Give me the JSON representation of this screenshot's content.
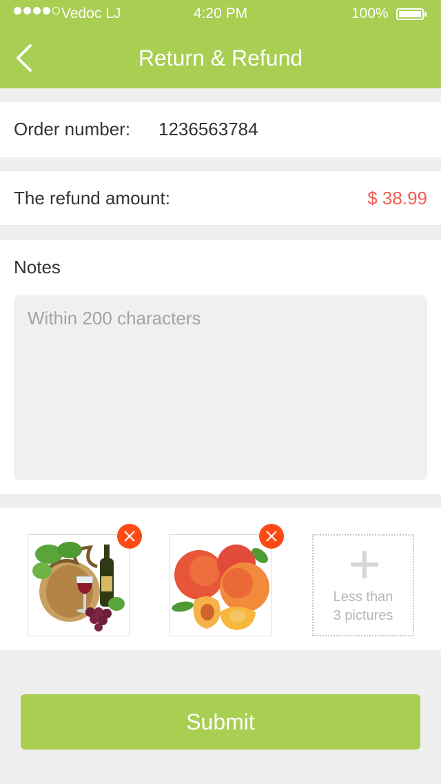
{
  "status_bar": {
    "carrier": "Vedoc LJ",
    "time": "4:20 PM",
    "battery": "100%"
  },
  "nav": {
    "back_icon": "chevron-left-icon",
    "title": "Return & Refund"
  },
  "order": {
    "label": "Order number:",
    "value": "1236563784"
  },
  "refund": {
    "label": "The refund amount:",
    "value": "$ 38.99"
  },
  "notes": {
    "label": "Notes",
    "placeholder": "Within 200 characters"
  },
  "photos": {
    "items": [
      {
        "icon": "wine-and-grapes-photo",
        "remove_icon": "close-icon"
      },
      {
        "icon": "peaches-photo",
        "remove_icon": "close-icon"
      }
    ],
    "add": {
      "icon": "plus-icon",
      "line1": "Less than",
      "line2": "3 pictures"
    }
  },
  "submit": {
    "label": "Submit"
  },
  "colors": {
    "brand": "#a8ce52",
    "amount": "#f25d52",
    "remove": "#fc4a14"
  }
}
